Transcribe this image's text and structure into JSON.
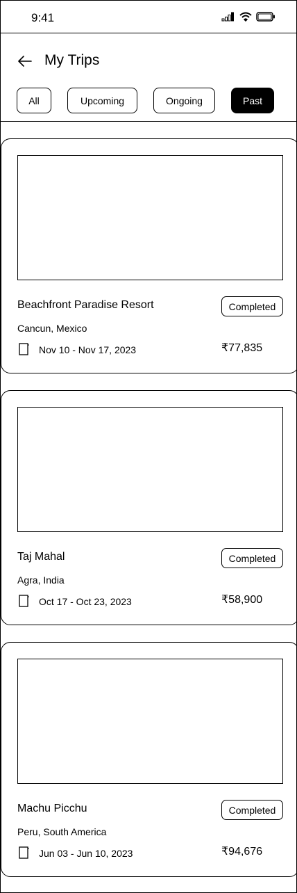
{
  "status_bar": {
    "time": "9:41",
    "icons": [
      "signal-icon",
      "wifi-icon",
      "battery-icon"
    ]
  },
  "header": {
    "back_icon": "arrow-left-icon",
    "title": "My Trips"
  },
  "filters": {
    "tabs": [
      {
        "label": "All",
        "active": false
      },
      {
        "label": "Upcoming",
        "active": false
      },
      {
        "label": "Ongoing",
        "active": false
      },
      {
        "label": "Past",
        "active": true
      }
    ]
  },
  "trips": [
    {
      "name": "Beachfront Paradise Resort",
      "location": "Cancun, Mexico",
      "status": "Completed",
      "dates": "Nov 10 - Nov 17, 2023",
      "price": "₹77,835",
      "date_icon": "calendar-icon"
    },
    {
      "name": "Taj Mahal",
      "location": "Agra, India",
      "status": "Completed",
      "dates": "Oct 17 - Oct 23, 2023",
      "price": "₹58,900",
      "date_icon": "calendar-icon"
    },
    {
      "name": "Machu Picchu",
      "location": "Peru, South America",
      "status": "Completed",
      "dates": "Jun 03 - Jun 10, 2023",
      "price": "₹94,676",
      "date_icon": "calendar-icon"
    }
  ]
}
